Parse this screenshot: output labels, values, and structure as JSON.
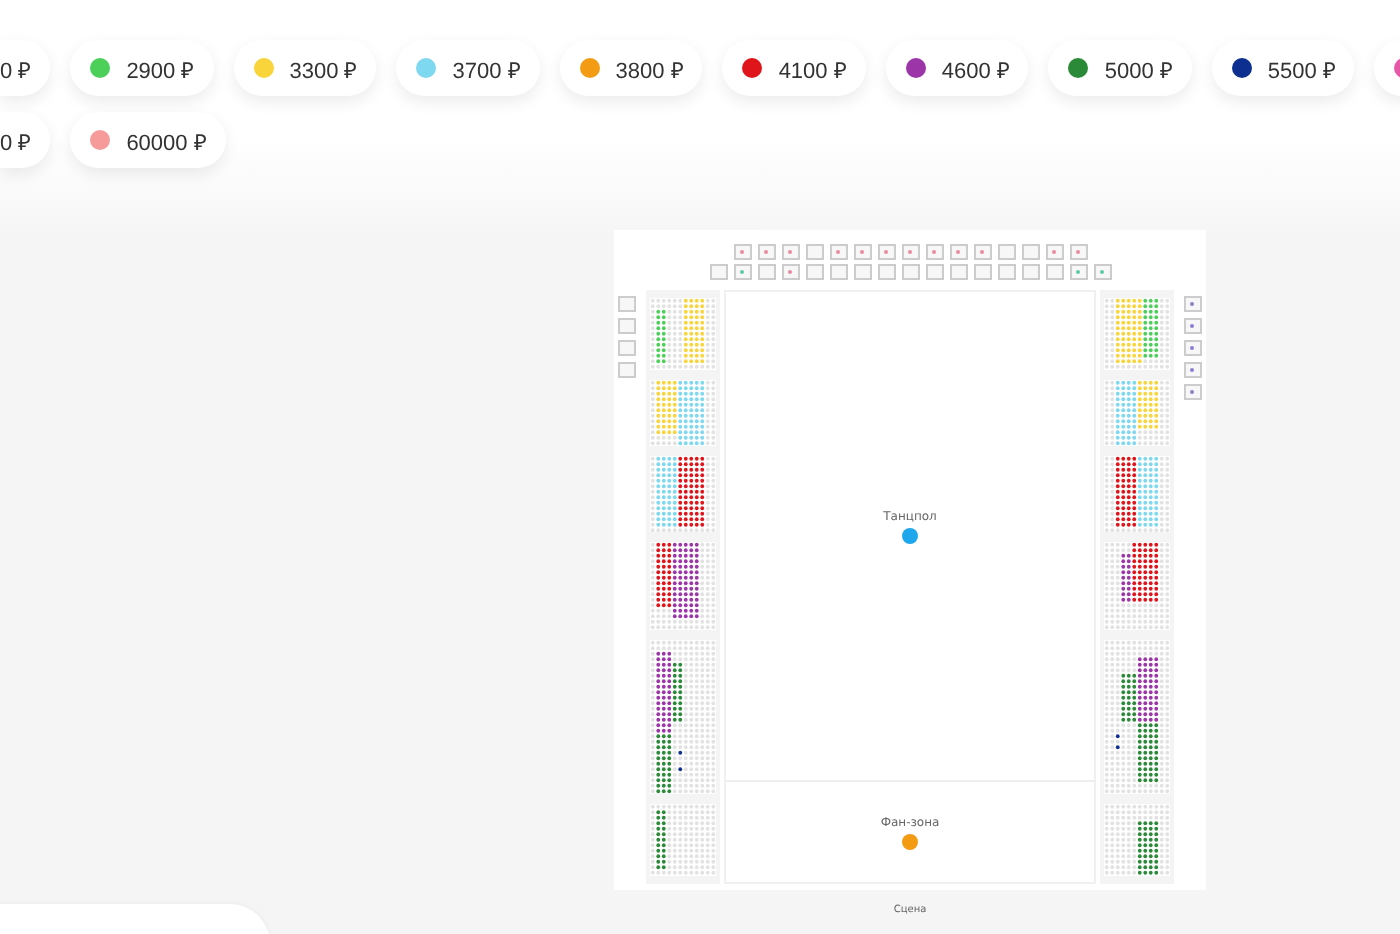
{
  "price_rows": [
    [
      {
        "label": "0 ₽"
      },
      {
        "label": "2900 ₽",
        "color": "#4cd05a"
      },
      {
        "label": "3300 ₽",
        "color": "#f9d43a"
      },
      {
        "label": "3700 ₽",
        "color": "#7dd8f0"
      },
      {
        "label": "3800 ₽",
        "color": "#f39b12"
      },
      {
        "label": "4100 ₽",
        "color": "#e0151b"
      },
      {
        "label": "4600 ₽",
        "color": "#9b35a8"
      },
      {
        "label": "5000 ₽",
        "color": "#2a8a38"
      },
      {
        "label": "5500 ₽",
        "color": "#0d2f8f"
      },
      {
        "color": "#e858a8"
      }
    ],
    [
      {
        "label": "0 ₽"
      },
      {
        "label": "60000 ₽",
        "color": "#f79a9a"
      }
    ]
  ],
  "map": {
    "zones": [
      {
        "label": "Танцпол",
        "color": "#1ea7ec"
      },
      {
        "label": "Фан-зона",
        "color": "#f39b12"
      }
    ],
    "stage": "Сцена"
  }
}
